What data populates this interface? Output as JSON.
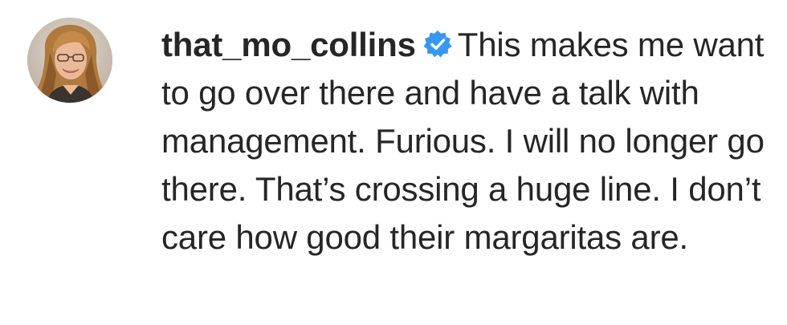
{
  "comment": {
    "username": "that_mo_collins",
    "verified": true,
    "verified_badge_color": "#3897f0",
    "text": "This makes me want to go over there and have a talk with management. Furious. I will no longer go there. That’s crossing a huge line. I don’t care how good their margaritas are.",
    "avatar_icon": "profile-photo"
  }
}
